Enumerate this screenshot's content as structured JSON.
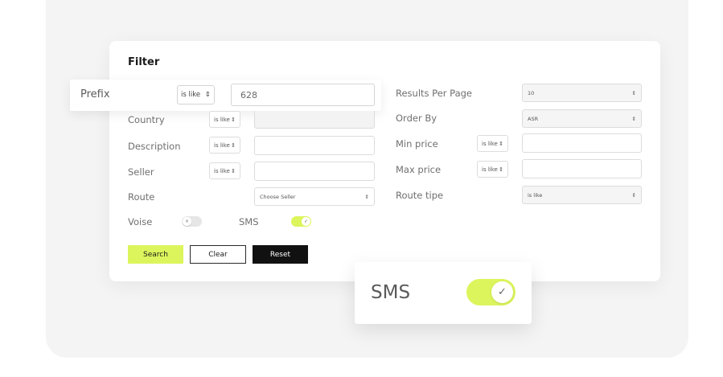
{
  "filter": {
    "title": "Filter",
    "prefix": {
      "label": "Prefix",
      "operator": "is like",
      "value": "628"
    },
    "country": {
      "label": "Country",
      "operator": "is like",
      "value": ""
    },
    "description": {
      "label": "Description",
      "operator": "is like",
      "value": ""
    },
    "seller": {
      "label": "Seller",
      "operator": "is like",
      "value": ""
    },
    "route": {
      "label": "Route",
      "selected": "Choose Seller"
    },
    "voise": {
      "label": "Voise",
      "enabled": false,
      "icon": "x-icon"
    },
    "sms": {
      "label": "SMS",
      "enabled": true,
      "icon": "check-icon"
    },
    "results_per_page": {
      "label": "Results Per Page",
      "selected": "10"
    },
    "order_by": {
      "label": "Order By",
      "selected": "ASR"
    },
    "min_price": {
      "label": "Min price",
      "operator": "is like",
      "value": ""
    },
    "max_price": {
      "label": "Max price",
      "operator": "is like",
      "value": ""
    },
    "route_tipe": {
      "label": "Route tipe",
      "selected": "is like"
    }
  },
  "buttons": {
    "search": "Search",
    "clear": "Clear",
    "reset": "Reset"
  },
  "sms_popout": {
    "label": "SMS",
    "enabled": true
  },
  "glyphs": {
    "arrows": "⇕",
    "x": "×",
    "check": "✓"
  },
  "colors": {
    "accent": "#dcf55c",
    "dark": "#111111",
    "backdrop": "#f4f4f5"
  }
}
